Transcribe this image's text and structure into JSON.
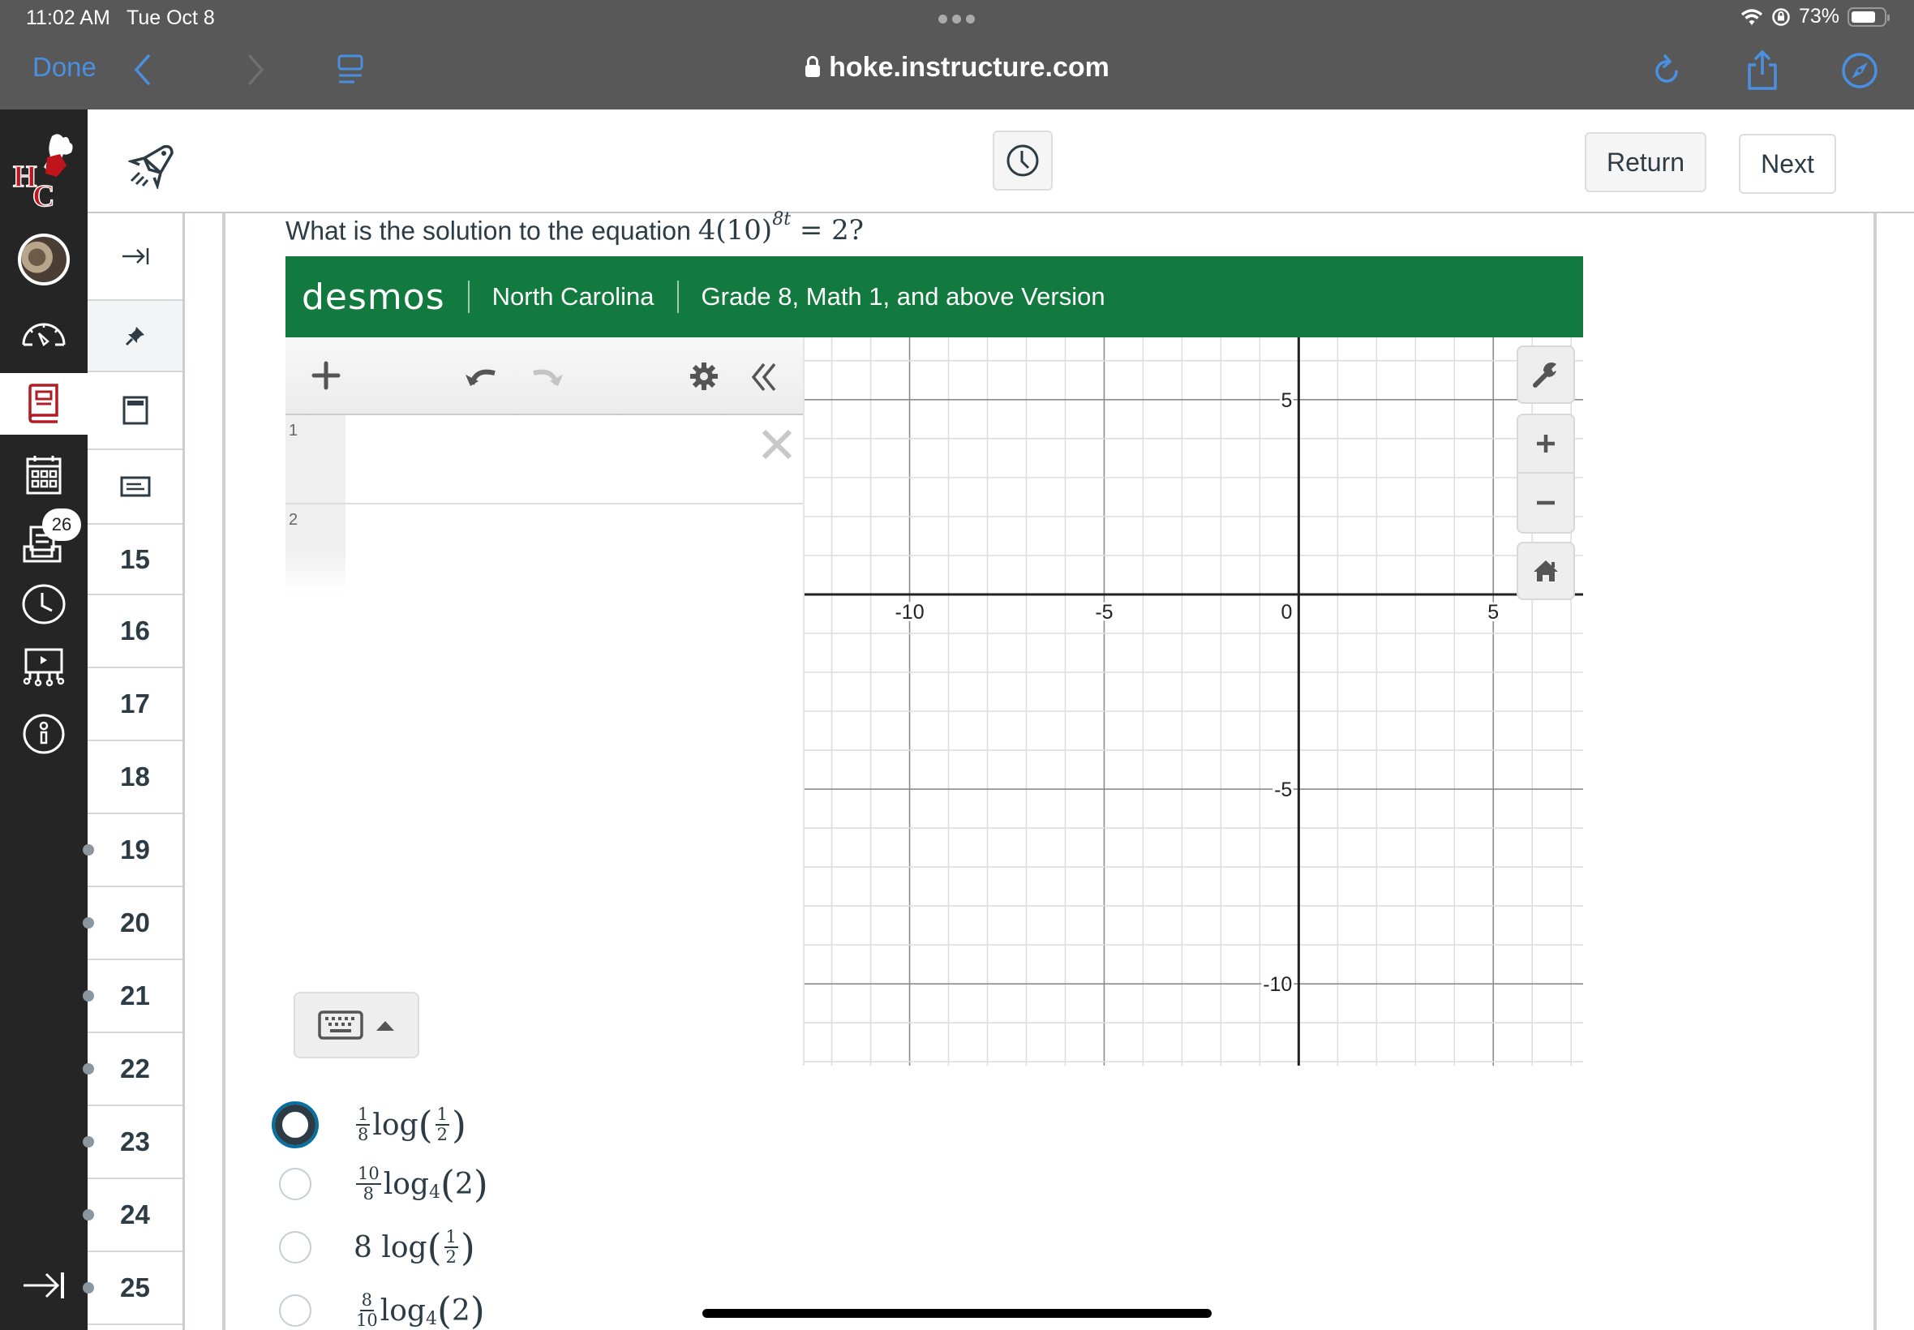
{
  "status_bar": {
    "time": "11:02 AM",
    "date": "Tue Oct 8",
    "battery_percent": "73%"
  },
  "browser": {
    "done_label": "Done",
    "url": "hoke.instructure.com",
    "icons": [
      "back-icon",
      "forward-icon",
      "reader-icon",
      "reload-icon",
      "share-icon",
      "compass-icon"
    ]
  },
  "global_nav": {
    "items": [
      {
        "name": "logo",
        "label": "HC"
      },
      {
        "name": "account"
      },
      {
        "name": "dashboard"
      },
      {
        "name": "courses",
        "active": true
      },
      {
        "name": "calendar"
      },
      {
        "name": "inbox",
        "badge": "26"
      },
      {
        "name": "history"
      },
      {
        "name": "studio"
      },
      {
        "name": "help"
      }
    ],
    "collapse_icon": "collapse-arrow-icon"
  },
  "header": {
    "timer_icon": "clock-icon",
    "return_label": "Return",
    "next_label": "Next"
  },
  "question_nav": {
    "top_icons": [
      "expand-icon",
      "pin-icon",
      "calculator-icon",
      "note-icon"
    ],
    "numbers": [
      "15",
      "16",
      "17",
      "18",
      "19",
      "20",
      "21",
      "22",
      "23",
      "24",
      "25"
    ],
    "answered_from": "19"
  },
  "question": {
    "prefix": "What is the solution to the equation ",
    "math_base": "4(10)",
    "math_exp": "8t",
    "math_rest": " = 2?"
  },
  "desmos": {
    "logo": "desmos",
    "region": "North Carolina",
    "version": "Grade 8, Math 1, and above Version",
    "brand_color": "#127a3f",
    "expressions": [
      {
        "index": "1",
        "value": ""
      },
      {
        "index": "2",
        "value": ""
      }
    ],
    "graph": {
      "x_ticks": [
        "-10",
        "-5",
        "0",
        "5"
      ],
      "y_ticks": [
        "5",
        "-5",
        "-10"
      ],
      "x_range": [
        -12.7,
        7.35
      ],
      "y_range": [
        -12.1,
        6.6
      ],
      "major_step": 5,
      "minor_step": 1
    }
  },
  "choices": [
    {
      "coef_num": "1",
      "coef_den": "8",
      "func": "log",
      "arg_num": "1",
      "arg_den": "2",
      "selected": true
    },
    {
      "coef_num": "10",
      "coef_den": "8",
      "func": "log",
      "base": "4",
      "arg": "2",
      "selected": false
    },
    {
      "coef_int": "8",
      "func": "log",
      "arg_num": "1",
      "arg_den": "2",
      "selected": false
    },
    {
      "coef_num": "8",
      "coef_den": "10",
      "func": "log",
      "base": "4",
      "arg": "2",
      "selected": false
    }
  ],
  "colors": {
    "ios_link_blue": "#4a90e2",
    "canvas_red": "#b21c24",
    "radio_selected": "#0770a3"
  }
}
